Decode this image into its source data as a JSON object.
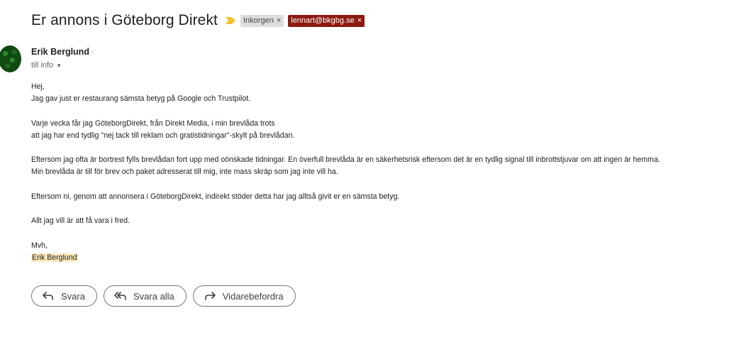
{
  "subject": "Er annons i Göteborg Direkt",
  "labels": {
    "inbox": "Inkorgen",
    "user": "lennart@bkgbg.se",
    "remove": "×"
  },
  "sender": {
    "name": "Erik Berglund",
    "email_hint": "<"
  },
  "recipient": {
    "text": "till info",
    "caret": "▼"
  },
  "body": {
    "lines": [
      "Hej,",
      "Jag gav just er restaurang sämsta betyg på Google och Trustpilot.",
      "",
      "Varje vecka får jag GöteborgDirekt, från Direkt Media, i min brevlåda trots",
      "att jag har end tydlig \"nej tack till reklam och gratistidningar\"-skylt på brevlådan.",
      "",
      "Eftersom jag ofta är bortrest fylls brevlådan fort upp med oönskade tidningar. En överfull brevlåda är en säkerhetsrisk eftersom det är en tydlig signal till inbrottstjuvar om att ingen är hemma.",
      "Min brevlåda är till för brev och paket adresserat till mig, inte mass skräp som jag inte vill ha.",
      "",
      "Eftersom ni, genom att annonsera i GöteborgDirekt, indirekt stöder detta har jag alltså givit er en sämsta betyg.",
      "",
      "Allt jag vill är att få vara i fred.",
      "",
      "Mvh,"
    ],
    "signature": "Erik Berglund"
  },
  "actions": {
    "reply": "Svara",
    "reply_all": "Svara alla",
    "forward": "Vidarebefordra"
  },
  "colors": {
    "label_user_bg": "#8b1a10",
    "label_inbox_bg": "#dddddd",
    "signature_highlight": "#fbe9b7",
    "importance": "#f2c230"
  },
  "icons": {
    "importance": "importance-marker-icon",
    "reply": "reply-icon",
    "reply_all": "reply-all-icon",
    "forward": "forward-icon"
  }
}
